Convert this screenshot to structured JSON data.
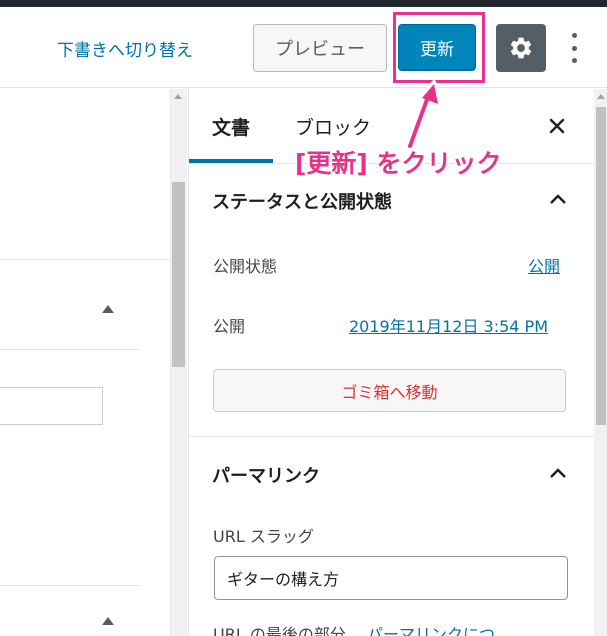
{
  "toolbar": {
    "draft_link": "下書きへ切り替え",
    "preview_label": "プレビュー",
    "update_label": "更新",
    "settings_icon": "gear-icon",
    "more_icon": "vertical-ellipsis-icon"
  },
  "sidebar": {
    "tabs": [
      {
        "label": "文書",
        "active": true
      },
      {
        "label": "ブロック",
        "active": false
      }
    ],
    "close_icon": "close-icon",
    "status_panel": {
      "title": "ステータスと公開状態",
      "visibility_label": "公開状態",
      "visibility_value": "公開",
      "publish_label": "公開",
      "publish_value": "2019年11月12日 3:54 PM",
      "trash_label": "ゴミ箱へ移動"
    },
    "permalink_panel": {
      "title": "パーマリンク",
      "slug_label": "URL スラッグ",
      "slug_value": "ギターの構え方",
      "help_prefix": "URL の最後の部分。",
      "help_link": "パーマリンクにつ"
    }
  },
  "annotation": {
    "text": "[更新] をクリック",
    "color": "#e8318a"
  },
  "colors": {
    "primary": "#0085ba",
    "link": "#0073aa",
    "danger": "#dc3232",
    "dark": "#555d66"
  }
}
